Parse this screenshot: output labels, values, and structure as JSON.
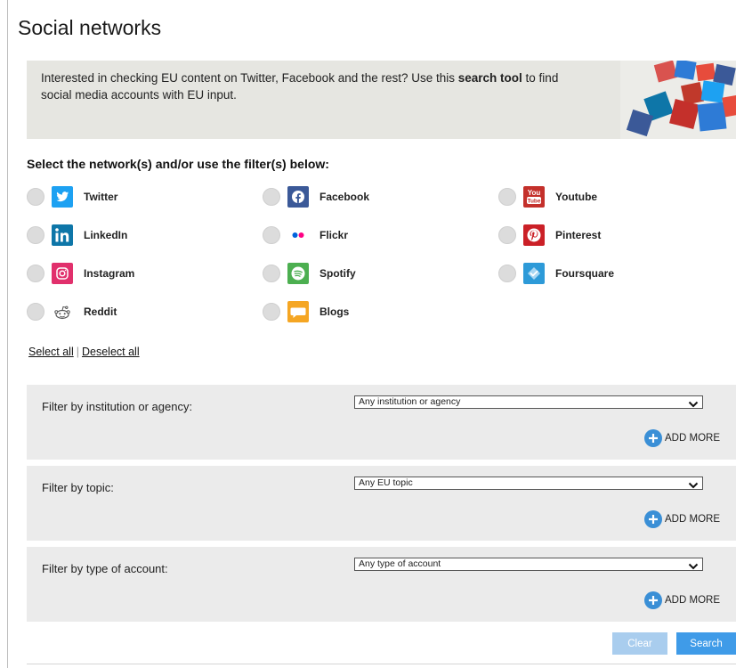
{
  "page": {
    "title": "Social networks"
  },
  "intro": {
    "text_before": "Interested in checking EU content on Twitter, Facebook and the rest? Use this ",
    "text_bold": "search tool",
    "text_after": " to find social media accounts with EU input."
  },
  "networks_heading": "Select the network(s) and/or use the filter(s) below:",
  "networks": [
    {
      "label": "Twitter",
      "icon": "twitter-icon",
      "color": "#1da1f2"
    },
    {
      "label": "Facebook",
      "icon": "facebook-icon",
      "color": "#3b5998"
    },
    {
      "label": "Youtube",
      "icon": "youtube-icon",
      "color": "#c4302b"
    },
    {
      "label": "LinkedIn",
      "icon": "linkedin-icon",
      "color": "#0e76a8"
    },
    {
      "label": "Flickr",
      "icon": "flickr-icon",
      "color": "#ff0084"
    },
    {
      "label": "Pinterest",
      "icon": "pinterest-icon",
      "color": "#cb2027"
    },
    {
      "label": "Instagram",
      "icon": "instagram-icon",
      "color": "#e1306c"
    },
    {
      "label": "Spotify",
      "icon": "spotify-icon",
      "color": "#4caf50"
    },
    {
      "label": "Foursquare",
      "icon": "foursquare-icon",
      "color": "#2d9ad8"
    },
    {
      "label": "Reddit",
      "icon": "reddit-icon",
      "color": "#555555"
    },
    {
      "label": "Blogs",
      "icon": "blogs-icon",
      "color": "#f5a623"
    }
  ],
  "select_links": {
    "select_all": "Select all",
    "separator": "|",
    "deselect_all": "Deselect all"
  },
  "filters": [
    {
      "label": "Filter by institution or agency:",
      "selected": "Any institution or agency",
      "add_more": "ADD MORE"
    },
    {
      "label": "Filter by topic:",
      "selected": "Any EU topic",
      "add_more": "ADD MORE"
    },
    {
      "label": "Filter by type of account:",
      "selected": "Any type of account",
      "add_more": "ADD MORE"
    }
  ],
  "buttons": {
    "clear": "Clear",
    "search": "Search"
  },
  "colors": {
    "accent": "#3f9be8",
    "accent_light": "#a9cdee",
    "panel": "#ebebeb"
  }
}
